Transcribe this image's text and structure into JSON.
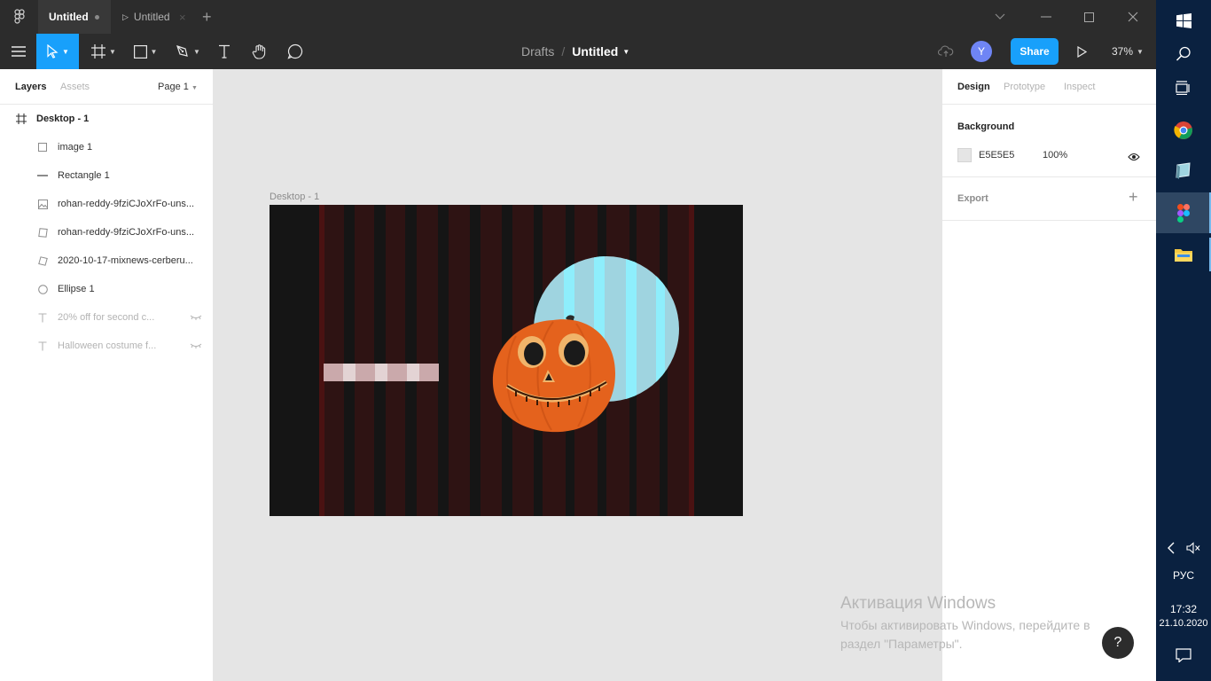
{
  "tabbar": {
    "active_tab": "Untitled",
    "second_tab": "Untitled"
  },
  "toolbar": {
    "breadcrumb_parent": "Drafts",
    "breadcrumb_separator": "/",
    "file_title": "Untitled",
    "avatar_initial": "Y",
    "share_label": "Share",
    "zoom": "37%"
  },
  "left_panel": {
    "tabs": [
      "Layers",
      "Assets"
    ],
    "page_selector": "Page 1",
    "layers": [
      {
        "name": "Desktop - 1",
        "icon": "frame-icon",
        "hidden": false
      },
      {
        "name": "image 1",
        "icon": "rectangle-icon",
        "hidden": false
      },
      {
        "name": "Rectangle 1",
        "icon": "line-icon",
        "hidden": false
      },
      {
        "name": "rohan-reddy-9fziCJoXrFo-uns...",
        "icon": "image-icon",
        "hidden": false
      },
      {
        "name": "rohan-reddy-9fziCJoXrFo-uns...",
        "icon": "skewed-rectangle-icon",
        "hidden": false
      },
      {
        "name": "2020-10-17-mixnews-cerberu...",
        "icon": "skewed-rectangle-icon",
        "hidden": false
      },
      {
        "name": "Ellipse 1",
        "icon": "ellipse-icon",
        "hidden": false
      },
      {
        "name": "20% off for second c...",
        "icon": "text-icon",
        "hidden": true
      },
      {
        "name": "Halloween costume f...",
        "icon": "text-icon",
        "hidden": true
      }
    ]
  },
  "canvas": {
    "frame_label": "Desktop - 1",
    "frame_background": "#151515",
    "stripe_color": "#2e1313",
    "circle_color": "#9fd4e0",
    "watermark_title": "Активация Windows",
    "watermark_line1": "Чтобы активировать Windows, перейдите в",
    "watermark_line2": "раздел \"Параметры\".",
    "help_label": "?"
  },
  "right_panel": {
    "tabs": [
      "Design",
      "Prototype",
      "Inspect"
    ],
    "background_title": "Background",
    "background_hex": "E5E5E5",
    "background_opacity": "100%",
    "export_title": "Export",
    "export_add": "+"
  },
  "taskbar": {
    "language": "РУС",
    "time": "17:32",
    "date": "21.10.2020"
  },
  "colors": {
    "accent": "#18a0fb",
    "chrome": "#2c2c2c",
    "canvas": "#e5e5e5",
    "taskbar": "#0a2140"
  }
}
